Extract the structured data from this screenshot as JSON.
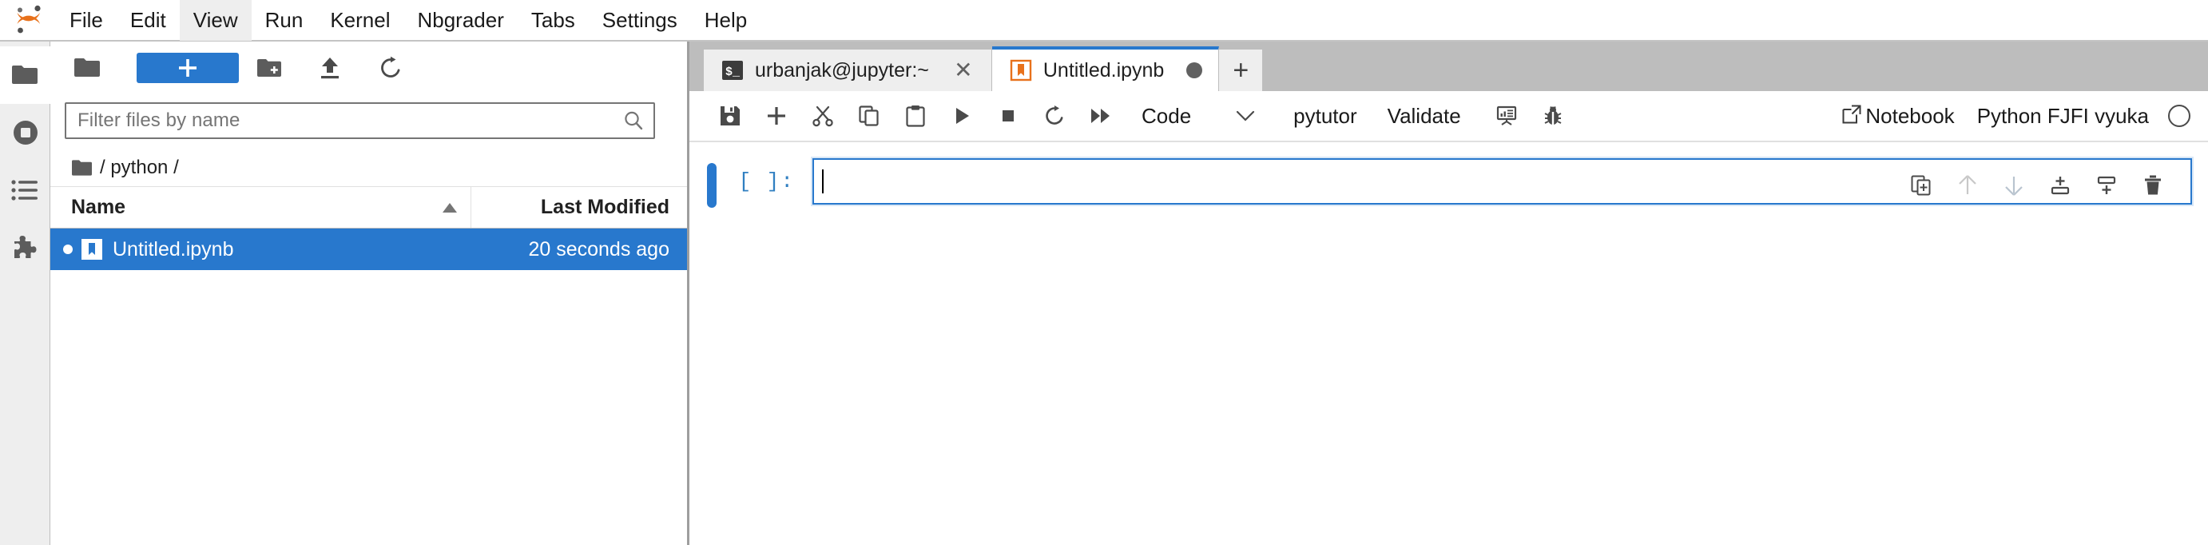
{
  "app": {
    "name": "JupyterLab",
    "logo_icon": "jupyter-logo"
  },
  "menubar": {
    "items": [
      {
        "label": "File",
        "active": false
      },
      {
        "label": "Edit",
        "active": false
      },
      {
        "label": "View",
        "active": true
      },
      {
        "label": "Run",
        "active": false
      },
      {
        "label": "Kernel",
        "active": false
      },
      {
        "label": "Nbgrader",
        "active": false
      },
      {
        "label": "Tabs",
        "active": false
      },
      {
        "label": "Settings",
        "active": false
      },
      {
        "label": "Help",
        "active": false
      }
    ]
  },
  "activity_bar": {
    "items": [
      {
        "icon": "folder-icon",
        "name": "file-browser",
        "selected": true
      },
      {
        "icon": "running-sessions-icon",
        "name": "running-terminals-kernels",
        "selected": false
      },
      {
        "icon": "commands-list-icon",
        "name": "commands",
        "selected": false
      },
      {
        "icon": "puzzle-piece-icon",
        "name": "extension-manager",
        "selected": false
      }
    ]
  },
  "file_browser": {
    "toolbar": {
      "folder_icon": "folder-icon",
      "new_launcher_label": "+",
      "new_folder_icon": "new-folder-icon",
      "upload_icon": "upload-icon",
      "refresh_icon": "refresh-icon"
    },
    "filter": {
      "placeholder": "Filter files by name",
      "value": "",
      "search_icon": "search-icon"
    },
    "breadcrumb": {
      "home_icon": "folder-icon",
      "path": "/ python /"
    },
    "columns": {
      "name": "Name",
      "last_modified": "Last Modified",
      "sort_direction_icon": "sort-ascending-icon"
    },
    "files": [
      {
        "name": "Untitled.ipynb",
        "last_modified": "20 seconds ago",
        "icon": "notebook-icon",
        "selected": true,
        "unsaved": true
      }
    ]
  },
  "tabs": {
    "items": [
      {
        "label": "urbanjak@jupyter:~",
        "icon": "terminal-icon",
        "active": false,
        "closable": true,
        "close_icon": "close-icon"
      },
      {
        "label": "Untitled.ipynb",
        "icon": "notebook-icon",
        "active": true,
        "dirty": true,
        "dirty_icon": "unsaved-dot-icon"
      }
    ],
    "add_tab_label": "+"
  },
  "notebook_toolbar": {
    "buttons": [
      {
        "icon": "save-icon",
        "name": "save-notebook"
      },
      {
        "icon": "plus-icon",
        "name": "insert-cell-below"
      },
      {
        "icon": "scissors-icon",
        "name": "cut-cells"
      },
      {
        "icon": "copy-icon",
        "name": "copy-cells"
      },
      {
        "icon": "paste-icon",
        "name": "paste-cells"
      },
      {
        "icon": "play-icon",
        "name": "run-cell"
      },
      {
        "icon": "stop-square-icon",
        "name": "interrupt-kernel"
      },
      {
        "icon": "restart-icon",
        "name": "restart-kernel"
      },
      {
        "icon": "fast-forward-icon",
        "name": "restart-and-run-all"
      }
    ],
    "cell_type": {
      "value": "Code",
      "chevron_icon": "chevron-down-icon"
    },
    "extensions": [
      {
        "label": "pytutor",
        "name": "pytutor-button"
      },
      {
        "label": "Validate",
        "name": "validate-button"
      }
    ],
    "extension_icons": [
      {
        "icon": "presentation-icon",
        "name": "rise-slideshow"
      },
      {
        "icon": "bug-icon",
        "name": "debugger-toggle"
      }
    ],
    "right": {
      "external_link_icon": "external-link-icon",
      "notebook_label": "Notebook",
      "kernel_name": "Python FJFI vyuka",
      "kernel_status_icon": "kernel-idle-circle-icon"
    }
  },
  "notebook": {
    "cells": [
      {
        "prompt": "[ ]:",
        "type": "code",
        "source": "",
        "active": true,
        "focused": true
      }
    ],
    "cell_toolbar": [
      {
        "icon": "duplicate-icon",
        "name": "duplicate-cell",
        "enabled": true
      },
      {
        "icon": "arrow-up-icon",
        "name": "move-cell-up",
        "enabled": false
      },
      {
        "icon": "arrow-down-icon",
        "name": "move-cell-down",
        "enabled": false
      },
      {
        "icon": "insert-above-icon",
        "name": "insert-cell-above",
        "enabled": true
      },
      {
        "icon": "insert-below-icon",
        "name": "insert-cell-below",
        "enabled": true
      },
      {
        "icon": "trash-icon",
        "name": "delete-cell",
        "enabled": true
      }
    ]
  },
  "colors": {
    "accent_blue": "#2878cd",
    "jupyter_orange": "#e8711b",
    "menu_active_bg": "#eeeeee",
    "tabbar_bg": "#bdbdbd",
    "icon_gray": "#5c5c5c",
    "disabled_gray": "#c8c8c8"
  }
}
